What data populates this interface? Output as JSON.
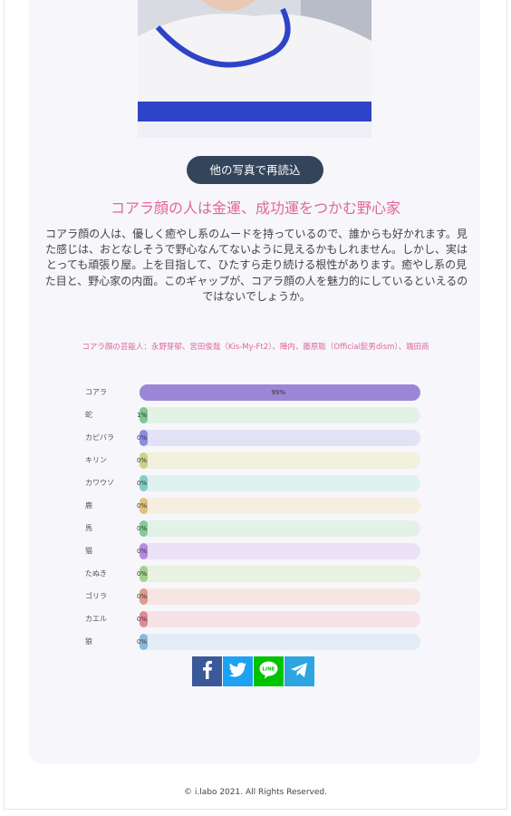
{
  "reload_button": "他の写真で再読込",
  "result": {
    "title": "コアラ顔の人は金運、成功運をつかむ野心家",
    "description": "コアラ顔の人は、優しく癒やし系のムードを持っているので、誰からも好かれます。見た感じは、おとなしそうで野心なんてないように見えるかもしれません。しかし、実はとっても頑張り屋。上を目指して、ひたすら走り続ける根性があります。癒やし系の見た目と、野心家の内面。このギャップが、コアラ顔の人を魅力的にしているといえるのではないでしょうか。",
    "celebrities": "コアラ顔の芸能人：永野芽郁、宮田俊哉（Kis-My-Ft2）、陣内、藤原聡（Official髭男dism）、端田商"
  },
  "bars": [
    {
      "label": "コアラ",
      "percent_label": "99%",
      "value": 99,
      "color": "#9b87d6",
      "track": "#9b87d6"
    },
    {
      "label": "蛇",
      "percent_label": "1%",
      "value": 1,
      "color": "#7cc98f",
      "track": "#e2f3e6"
    },
    {
      "label": "カピバラ",
      "percent_label": "0%",
      "value": 0,
      "color": "#8c8ce0",
      "track": "#e2e2f6"
    },
    {
      "label": "キリン",
      "percent_label": "0%",
      "value": 0,
      "color": "#cfd08a",
      "track": "#f1f1dd"
    },
    {
      "label": "カワウソ",
      "percent_label": "0%",
      "value": 0,
      "color": "#7fcfc6",
      "track": "#e0f2ef"
    },
    {
      "label": "鹿",
      "percent_label": "0%",
      "value": 0,
      "color": "#e2c07e",
      "track": "#f6efdf"
    },
    {
      "label": "馬",
      "percent_label": "0%",
      "value": 0,
      "color": "#82cc96",
      "track": "#e2f2e6"
    },
    {
      "label": "猫",
      "percent_label": "0%",
      "value": 0,
      "color": "#b78ae0",
      "track": "#ece2f6"
    },
    {
      "label": "たぬき",
      "percent_label": "0%",
      "value": 0,
      "color": "#a3d08c",
      "track": "#e8f2e0"
    },
    {
      "label": "ゴリラ",
      "percent_label": "0%",
      "value": 0,
      "color": "#e09a8c",
      "track": "#f6e6e3"
    },
    {
      "label": "カエル",
      "percent_label": "0%",
      "value": 0,
      "color": "#e08a96",
      "track": "#f6e2e6"
    },
    {
      "label": "狼",
      "percent_label": "0%",
      "value": 0,
      "color": "#8ab8d8",
      "track": "#e2edf5"
    }
  ],
  "share": [
    {
      "name": "facebook",
      "color": "#3b5998"
    },
    {
      "name": "twitter",
      "color": "#1da1f2"
    },
    {
      "name": "line",
      "color": "#00c300"
    },
    {
      "name": "telegram",
      "color": "#2ca5e0"
    }
  ],
  "footer": "© i.labo 2021. All Rights Reserved."
}
